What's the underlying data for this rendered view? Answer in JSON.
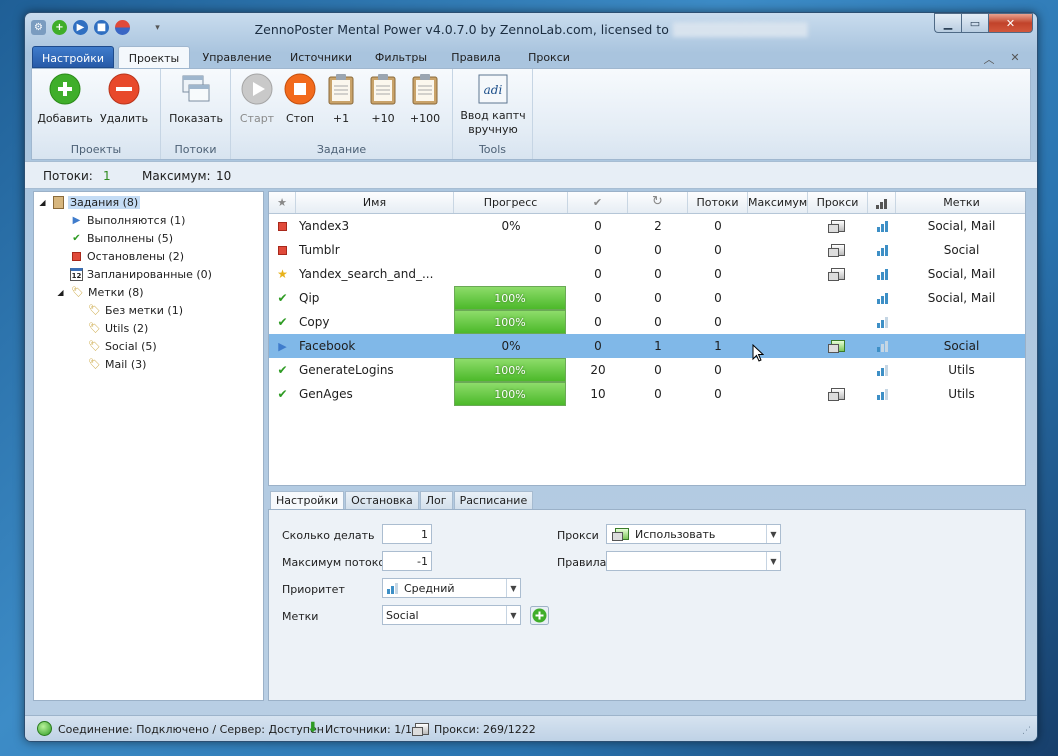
{
  "window": {
    "title": "ZennoPoster Mental Power v4.0.7.0 by ZennoLab.com, licensed to",
    "licensee_hidden": "██████████████"
  },
  "tabs": [
    "Настройки",
    "Проекты",
    "Управление",
    "Источники",
    "Фильтры",
    "Правила",
    "Прокси"
  ],
  "ribbon": {
    "groups": [
      "Проекты",
      "Потоки",
      "Задание",
      "Tools"
    ],
    "buttons": {
      "add": "Добавить",
      "remove": "Удалить",
      "show": "Показать",
      "start": "Старт",
      "stop": "Стоп",
      "p1": "+1",
      "p10": "+10",
      "p100": "+100",
      "captcha": "Ввод каптч вручную"
    }
  },
  "counters": {
    "threads_label": "Потоки:",
    "threads_value": "1",
    "max_label": "Максимум:",
    "max_value": "10"
  },
  "tree": {
    "tasks": "Задания (8)",
    "running": "Выполняются (1)",
    "done": "Выполнены (5)",
    "stopped": "Остановлены (2)",
    "scheduled": "Запланированные (0)",
    "labels": "Метки (8)",
    "no_label": "Без метки (1)",
    "utils": "Utils (2)",
    "social": "Social (5)",
    "mail": "Mail (3)"
  },
  "grid": {
    "headers": {
      "star": "★",
      "name": "Имя",
      "progress": "Прогресс",
      "done": "✔",
      "repeat": "↻",
      "threads": "Потоки",
      "max": "Максимум",
      "proxy": "Прокси",
      "labels": "Метки"
    },
    "rows": [
      {
        "status": "stopped",
        "name": "Yandex3",
        "progress": "0%",
        "pct": 0,
        "done": "0",
        "repeat": "2",
        "threads": "0",
        "proxy": true,
        "signal": 3,
        "labels": "Social, Mail"
      },
      {
        "status": "stopped",
        "name": "Tumblr",
        "progress": "",
        "pct": 0,
        "done": "0",
        "repeat": "0",
        "threads": "0",
        "proxy": true,
        "signal": 3,
        "labels": "Social"
      },
      {
        "status": "scheduled",
        "name": "Yandex_search_and_...",
        "progress": "",
        "pct": 0,
        "done": "0",
        "repeat": "0",
        "threads": "0",
        "proxy": true,
        "signal": 3,
        "labels": "Social, Mail"
      },
      {
        "status": "done",
        "name": "Qip",
        "progress": "100%",
        "pct": 100,
        "done": "0",
        "repeat": "0",
        "threads": "0",
        "proxy": false,
        "signal": 3,
        "labels": "Social, Mail"
      },
      {
        "status": "done",
        "name": "Copy",
        "progress": "100%",
        "pct": 100,
        "done": "0",
        "repeat": "0",
        "threads": "0",
        "proxy": false,
        "signal": 2,
        "labels": ""
      },
      {
        "status": "running",
        "name": "Facebook",
        "progress": "0%",
        "pct": 0,
        "done": "0",
        "repeat": "1",
        "threads": "1",
        "proxy": true,
        "proxy_green": true,
        "signal": 1,
        "labels": "Social",
        "selected": true
      },
      {
        "status": "done",
        "name": "GenerateLogins",
        "progress": "100%",
        "pct": 100,
        "done": "20",
        "repeat": "0",
        "threads": "0",
        "proxy": false,
        "signal": 2,
        "labels": "Utils"
      },
      {
        "status": "done",
        "name": "GenAges",
        "progress": "100%",
        "pct": 100,
        "done": "10",
        "repeat": "0",
        "threads": "0",
        "proxy": true,
        "signal": 2,
        "labels": "Utils"
      }
    ]
  },
  "panel": {
    "tabs": [
      "Настройки",
      "Остановка",
      "Лог",
      "Расписание"
    ],
    "how_many_label": "Сколько делать",
    "how_many_value": "1",
    "max_threads_label": "Максимум потоков",
    "max_threads_value": "-1",
    "priority_label": "Приоритет",
    "priority_value": "Средний",
    "labels_label": "Метки",
    "labels_value": "Social",
    "proxy_label": "Прокси",
    "proxy_value": "Использовать",
    "rules_label": "Правила",
    "rules_value": ""
  },
  "status": {
    "connection": "Соединение: Подключено / Сервер: Доступен",
    "sources": "Источники: 1/1",
    "proxies": "Прокси: 269/1222"
  },
  "colors": {
    "accent": "#3f7ccc",
    "selected_row": "#80b8e8",
    "progress": "#4cb92a",
    "stop": "#e8492b",
    "add": "#3fae2a"
  }
}
